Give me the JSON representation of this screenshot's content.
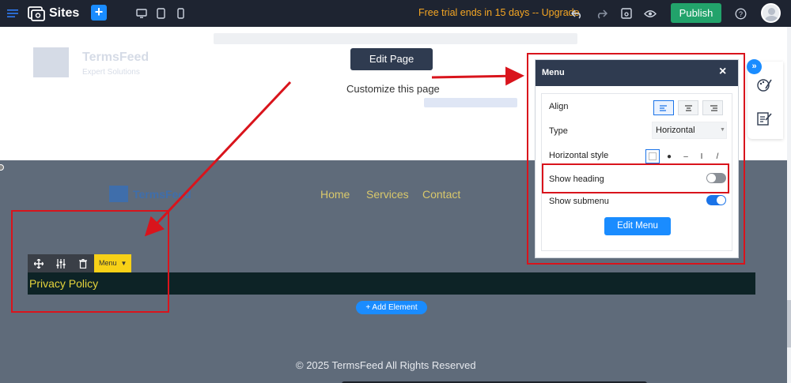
{
  "topbar": {
    "site_label": "Sites",
    "plus_label": "+",
    "trial_text": "Free trial ends in 15 days -- Upgrade",
    "publish_label": "Publish",
    "icons": [
      "hamburger-icon",
      "sites-icon",
      "plus-icon",
      "desktop-icon",
      "tablet-icon",
      "mobile-icon",
      "undo-icon",
      "redo-icon",
      "save-icon",
      "preview-icon",
      "help-icon",
      "avatar-icon"
    ]
  },
  "upper": {
    "logo_name": "TermsFeed",
    "logo_tagline": "Expert Solutions",
    "edit_page_label": "Edit Page",
    "customize_text": "Customize this page"
  },
  "footer": {
    "logo_name": "TermsFeed",
    "nav": [
      "Home",
      "Services",
      "Contact"
    ],
    "menu_tag_label": "Menu",
    "privacy_text": "Privacy Policy",
    "add_element_label": "+ Add Element",
    "copyright": "© 2025 TermsFeed All Rights Reserved"
  },
  "panel": {
    "title": "Menu",
    "close_label": "×",
    "align_label": "Align",
    "type_label": "Type",
    "type_value": "Horizontal",
    "horizontal_style_label": "Horizontal style",
    "horizontal_styles": [
      "",
      "●",
      "–",
      "I",
      "/"
    ],
    "show_heading_label": "Show heading",
    "show_heading_on": false,
    "show_submenu_label": "Show submenu",
    "show_submenu_on": true,
    "edit_menu_label": "Edit Menu"
  },
  "colors": {
    "topbar": "#1e2431",
    "accent": "#1a8cff",
    "publish": "#22a36b",
    "trial": "#f5a623",
    "footer_bg": "#5f6b7a",
    "nav_text": "#d9c86b",
    "annotation_red": "#d9141c",
    "panel_header": "#2f3b50"
  }
}
